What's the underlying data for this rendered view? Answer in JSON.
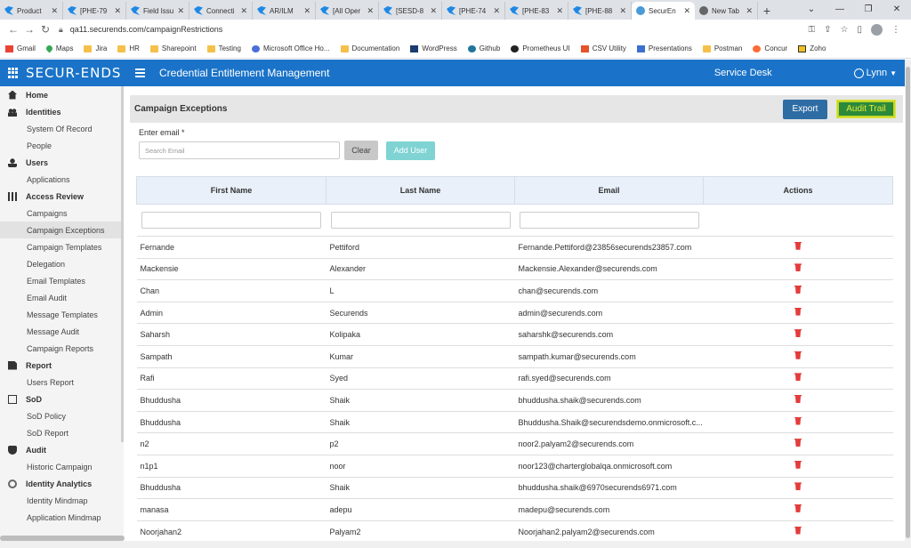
{
  "browser": {
    "tabs": [
      {
        "title": "Product",
        "icon": "jira-icon"
      },
      {
        "title": "[PHE-79",
        "icon": "jira-icon"
      },
      {
        "title": "Field Issu",
        "icon": "jira-icon"
      },
      {
        "title": "Connecti",
        "icon": "jira-icon"
      },
      {
        "title": "AR/ILM",
        "icon": "jira-icon"
      },
      {
        "title": "[All Oper",
        "icon": "jira-icon"
      },
      {
        "title": "[SESD-8",
        "icon": "jira-icon"
      },
      {
        "title": "[PHE-74",
        "icon": "jira-icon"
      },
      {
        "title": "[PHE-83",
        "icon": "jira-icon"
      },
      {
        "title": "[PHE-88",
        "icon": "jira-icon"
      },
      {
        "title": "SecurEn",
        "icon": "securends-icon",
        "active": true
      },
      {
        "title": "New Tab",
        "icon": "chrome-icon"
      }
    ],
    "url": "qa11.securends.com/campaignRestrictions",
    "bookmarks": [
      "Gmail",
      "Maps",
      "Jira",
      "HR",
      "Sharepoint",
      "Testing",
      "Microsoft Office Ho...",
      "Documentation",
      "WordPress",
      "Github",
      "Prometheus UI",
      "CSV Utility",
      "Presentations",
      "Postman",
      "Concur",
      "Zoho"
    ]
  },
  "header": {
    "logo": "SECUR-ENDS",
    "title": "Credential Entitlement Management",
    "service_desk": "Service Desk",
    "user": "Lynn",
    "accent": "#1a73c8"
  },
  "sidebar": [
    {
      "label": "Home",
      "section": true,
      "icon": "home-icon"
    },
    {
      "label": "Identities",
      "section": true,
      "icon": "people-icon"
    },
    {
      "label": "System Of Record"
    },
    {
      "label": "People"
    },
    {
      "label": "Users",
      "section": true,
      "icon": "user-icon"
    },
    {
      "label": "Applications"
    },
    {
      "label": "Access Review",
      "section": true,
      "icon": "grid-icon"
    },
    {
      "label": "Campaigns"
    },
    {
      "label": "Campaign Exceptions",
      "active": true
    },
    {
      "label": "Campaign Templates"
    },
    {
      "label": "Delegation"
    },
    {
      "label": "Email Templates"
    },
    {
      "label": "Email Audit"
    },
    {
      "label": "Message Templates"
    },
    {
      "label": "Message Audit"
    },
    {
      "label": "Campaign Reports"
    },
    {
      "label": "Report",
      "section": true,
      "icon": "document-icon"
    },
    {
      "label": "Users Report"
    },
    {
      "label": "SoD",
      "section": true,
      "icon": "box-icon"
    },
    {
      "label": "SoD Policy"
    },
    {
      "label": "SoD Report"
    },
    {
      "label": "Audit",
      "section": true,
      "icon": "shield-icon"
    },
    {
      "label": "Historic Campaign"
    },
    {
      "label": "Identity Analytics",
      "section": true,
      "icon": "analytics-icon"
    },
    {
      "label": "Identity Mindmap"
    },
    {
      "label": "Application Mindmap"
    }
  ],
  "panel": {
    "title": "Campaign Exceptions",
    "export_label": "Export",
    "audit_label": "Audit Trail",
    "email_label": "Enter email *",
    "email_placeholder": "Search Email",
    "clear_label": "Clear",
    "add_user_label": "Add User"
  },
  "table": {
    "headers": [
      "First Name",
      "Last Name",
      "Email",
      "Actions"
    ],
    "rows": [
      {
        "first": "Fernande",
        "last": "Pettiford",
        "email": "Fernande.Pettiford@23856securends23857.com"
      },
      {
        "first": "Mackensie",
        "last": "Alexander",
        "email": "Mackensie.Alexander@securends.com"
      },
      {
        "first": "Chan",
        "last": "L",
        "email": "chan@securends.com"
      },
      {
        "first": "Admin",
        "last": "Securends",
        "email": "admin@securends.com"
      },
      {
        "first": "Saharsh",
        "last": "Kolipaka",
        "email": "saharshk@securends.com"
      },
      {
        "first": "Sampath",
        "last": "Kumar",
        "email": "sampath.kumar@securends.com"
      },
      {
        "first": "Rafi",
        "last": "Syed",
        "email": "rafi.syed@securends.com"
      },
      {
        "first": "Bhuddusha",
        "last": "Shaik",
        "email": "bhuddusha.shaik@securends.com"
      },
      {
        "first": "Bhuddusha",
        "last": "Shaik",
        "email": "Bhuddusha.Shaik@securendsdemo.onmicrosoft.c..."
      },
      {
        "first": "n2",
        "last": "p2",
        "email": "noor2.palyam2@securends.com"
      },
      {
        "first": "n1p1",
        "last": "noor",
        "email": "noor123@charterglobalqa.onmicrosoft.com"
      },
      {
        "first": "Bhuddusha",
        "last": "Shaik",
        "email": "bhuddusha.shaik@6970securends6971.com"
      },
      {
        "first": "manasa",
        "last": "adepu",
        "email": "madepu@securends.com"
      },
      {
        "first": "Noorjahan2",
        "last": "Palyam2",
        "email": "Noorjahan2.palyam2@securends.com"
      }
    ]
  }
}
